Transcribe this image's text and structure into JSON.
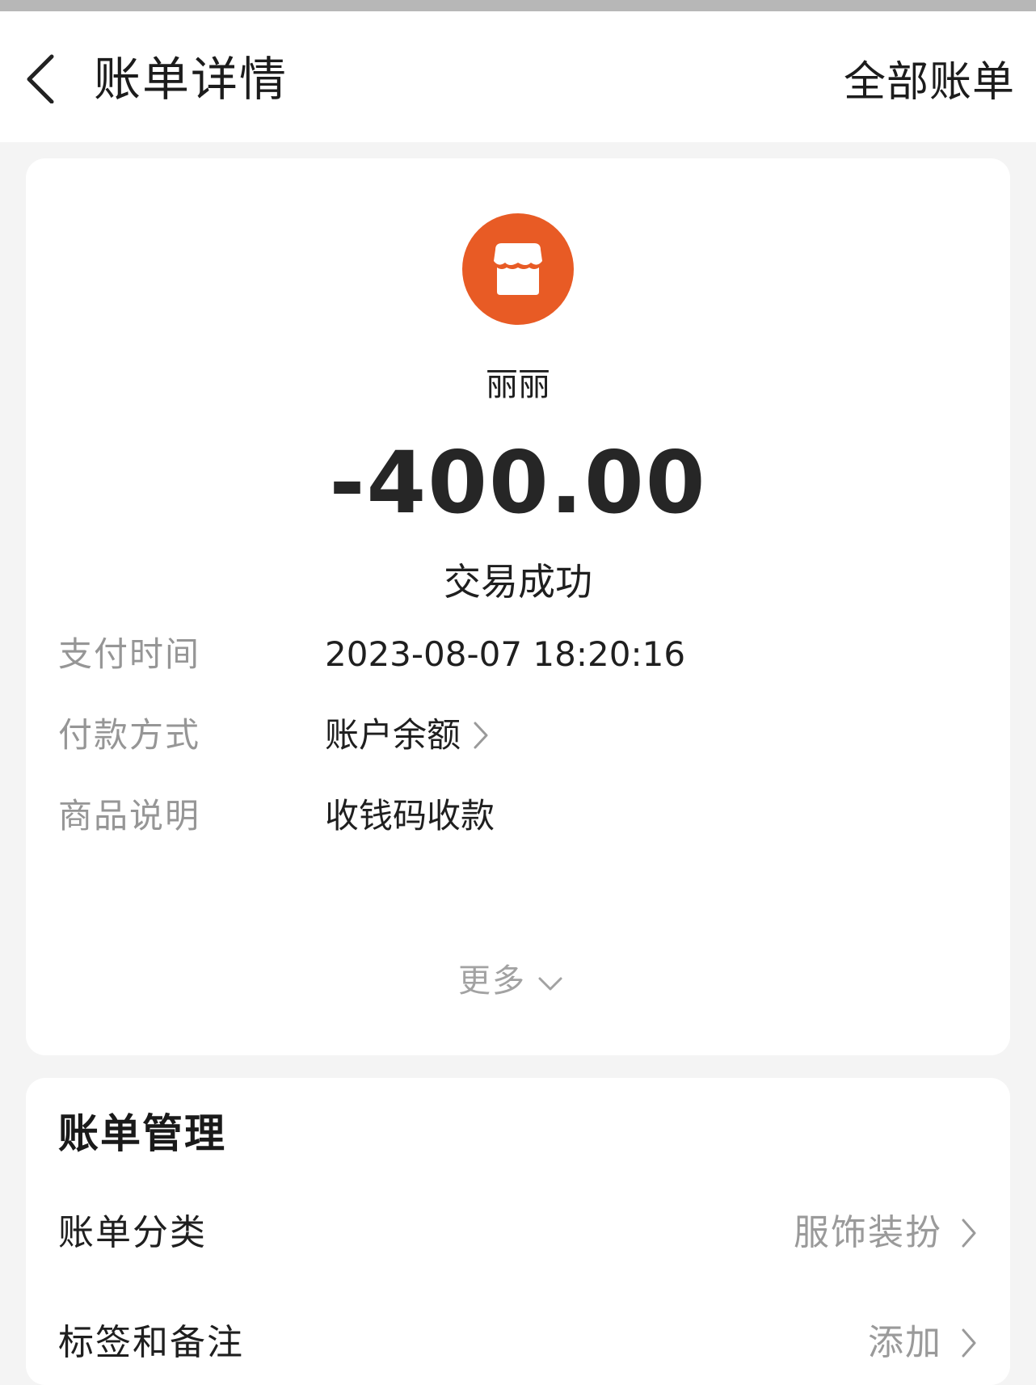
{
  "header": {
    "title": "账单详情",
    "action_label": "全部账单"
  },
  "transaction": {
    "merchant_icon": "shop-storefront-icon",
    "merchant_name": "丽丽",
    "amount": "-400.00",
    "status": "交易成功"
  },
  "details": [
    {
      "label": "支付时间",
      "value": "2023-08-07 18:20:16"
    },
    {
      "label": "付款方式",
      "value": "账户余额"
    },
    {
      "label": "商品说明",
      "value": "收钱码收款"
    }
  ],
  "more_label": "更多",
  "management": {
    "title": "账单管理",
    "rows": [
      {
        "label": "账单分类",
        "value": "服饰装扮"
      },
      {
        "label": "标签和备注",
        "value": "添加"
      }
    ]
  },
  "colors": {
    "accent": "#e85b25",
    "label_gray": "#969696",
    "page_bg": "#f4f4f4"
  }
}
